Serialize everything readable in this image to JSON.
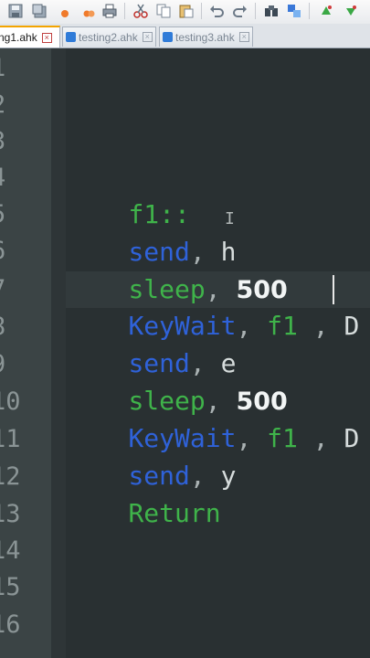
{
  "tabs": [
    {
      "label": "ng1.ahk",
      "active": true
    },
    {
      "label": "testing2.ahk",
      "active": false
    },
    {
      "label": "testing3.ahk",
      "active": false
    }
  ],
  "editor": {
    "line_numbers": [
      "1",
      "2",
      "3",
      "4",
      "5",
      "6",
      "7",
      "8",
      "9",
      "10",
      "11",
      "12",
      "13",
      "14",
      "15",
      "16"
    ],
    "lines": {
      "l4": {
        "a": "f1::"
      },
      "l5": {
        "a": "send",
        "b": ",",
        "c": " h"
      },
      "l6": {
        "a": "sleep",
        "b": ",",
        "c": "500"
      },
      "l7": {
        "a": "KeyWait",
        "b": ",",
        "c": "f1",
        "d": " ,",
        "e": "D"
      },
      "l8": {
        "a": "send",
        "b": ",",
        "c": " e"
      },
      "l9": {
        "a": "sleep",
        "b": ",",
        "c": "500"
      },
      "l10": {
        "a": "KeyWait",
        "b": ",",
        "c": "f1",
        "d": " ,",
        "e": "D"
      },
      "l11": {
        "a": "send",
        "b": ",",
        "c": " y"
      },
      "l12": {
        "a": "Return"
      }
    }
  },
  "colors": {
    "keyword_green": "#3fb34a",
    "keyword_blue": "#2f62d9",
    "editor_bg": "#293032"
  }
}
